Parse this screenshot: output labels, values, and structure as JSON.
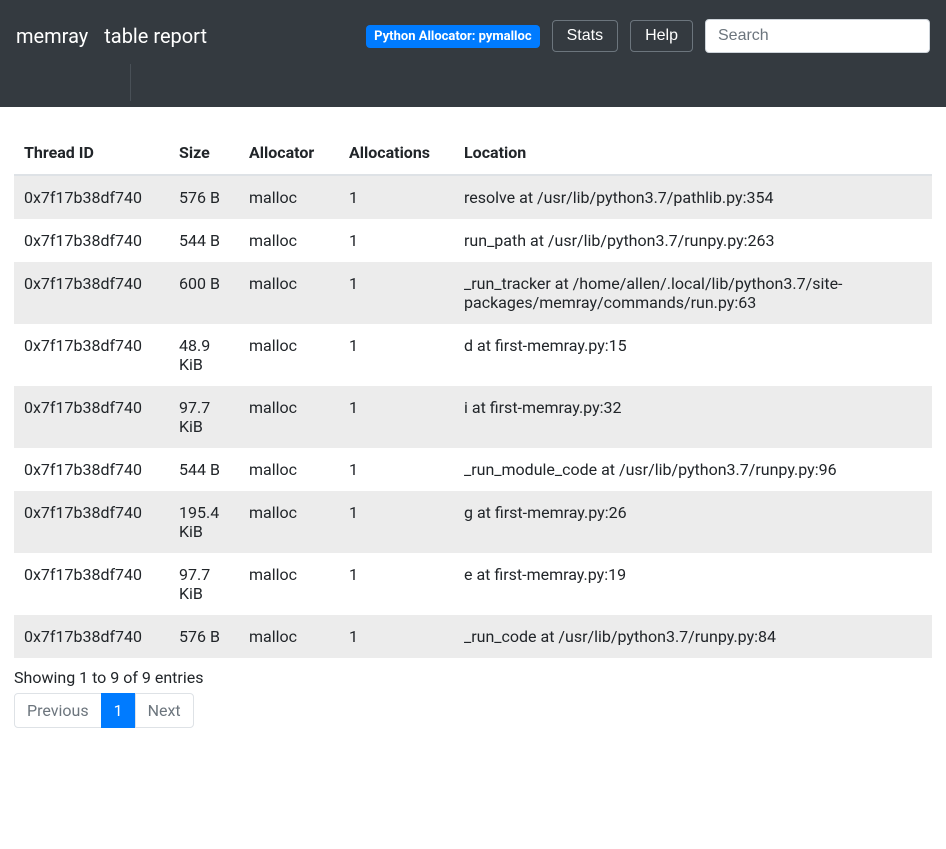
{
  "navbar": {
    "brand": "memray",
    "title": "table report",
    "badge": "Python Allocator: pymalloc",
    "stats_label": "Stats",
    "help_label": "Help",
    "search_placeholder": "Search"
  },
  "table": {
    "headers": {
      "thread_id": "Thread ID",
      "size": "Size",
      "allocator": "Allocator",
      "allocations": "Allocations",
      "location": "Location"
    },
    "rows": [
      {
        "thread_id": "0x7f17b38df740",
        "size": "576 B",
        "allocator": "malloc",
        "allocations": "1",
        "location": "resolve at /usr/lib/python3.7/pathlib.py:354"
      },
      {
        "thread_id": "0x7f17b38df740",
        "size": "544 B",
        "allocator": "malloc",
        "allocations": "1",
        "location": "run_path at /usr/lib/python3.7/runpy.py:263"
      },
      {
        "thread_id": "0x7f17b38df740",
        "size": "600 B",
        "allocator": "malloc",
        "allocations": "1",
        "location": "_run_tracker at /home/allen/.local/lib/python3.7/site-packages/memray/commands/run.py:63"
      },
      {
        "thread_id": "0x7f17b38df740",
        "size": "48.9 KiB",
        "allocator": "malloc",
        "allocations": "1",
        "location": "d at first-memray.py:15"
      },
      {
        "thread_id": "0x7f17b38df740",
        "size": "97.7 KiB",
        "allocator": "malloc",
        "allocations": "1",
        "location": "i at first-memray.py:32"
      },
      {
        "thread_id": "0x7f17b38df740",
        "size": "544 B",
        "allocator": "malloc",
        "allocations": "1",
        "location": "_run_module_code at /usr/lib/python3.7/runpy.py:96"
      },
      {
        "thread_id": "0x7f17b38df740",
        "size": "195.4 KiB",
        "allocator": "malloc",
        "allocations": "1",
        "location": "g at first-memray.py:26"
      },
      {
        "thread_id": "0x7f17b38df740",
        "size": "97.7 KiB",
        "allocator": "malloc",
        "allocations": "1",
        "location": "e at first-memray.py:19"
      },
      {
        "thread_id": "0x7f17b38df740",
        "size": "576 B",
        "allocator": "malloc",
        "allocations": "1",
        "location": "_run_code at /usr/lib/python3.7/runpy.py:84"
      }
    ]
  },
  "footer": {
    "info": "Showing 1 to 9 of 9 entries",
    "previous_label": "Previous",
    "page_1_label": "1",
    "next_label": "Next"
  }
}
